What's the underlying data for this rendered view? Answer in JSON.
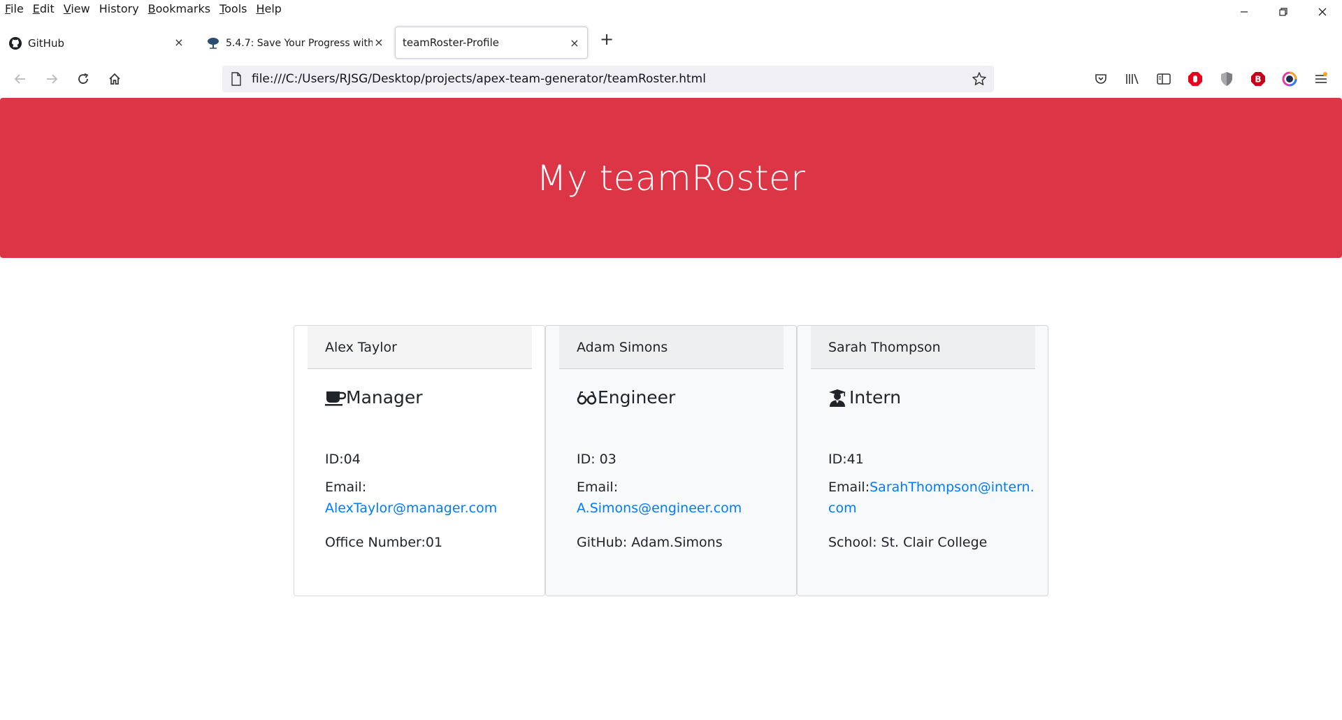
{
  "menu": {
    "items": [
      {
        "label": "File",
        "key": "F",
        "rest": "ile"
      },
      {
        "label": "Edit",
        "key": "E",
        "rest": "dit"
      },
      {
        "label": "View",
        "key": "V",
        "rest": "iew"
      },
      {
        "label": "History",
        "key": "",
        "rest": "History"
      },
      {
        "label": "Bookmarks",
        "key": "B",
        "rest": "ookmarks"
      },
      {
        "label": "Tools",
        "key": "T",
        "rest": "ools"
      },
      {
        "label": "Help",
        "key": "H",
        "rest": "elp"
      }
    ]
  },
  "tabs": [
    {
      "title": "GitHub",
      "icon": "github-icon",
      "active": false
    },
    {
      "title": "5.4.7: Save Your Progress with Gi",
      "icon": "tree-icon",
      "active": false
    },
    {
      "title": "teamRoster-Profile",
      "icon": "",
      "active": true
    }
  ],
  "urlbar": {
    "url": "file:///C:/Users/RJSG/Desktop/projects/apex-team-generator/teamRoster.html"
  },
  "page": {
    "heading": "My teamRoster",
    "hero_color": "#dc3545",
    "link_color": "#007bff"
  },
  "cards": [
    {
      "name": "Alex Taylor",
      "role": "Manager",
      "role_icon": "mug-icon",
      "id_line": "ID:04",
      "email_label": "Email:",
      "email": "AlexTaylor@manager.com",
      "extra": "Office Number:01"
    },
    {
      "name": "Adam Simons",
      "role": "Engineer",
      "role_icon": "glasses-icon",
      "id_line": "ID: 03",
      "email_label": "Email:",
      "email": "A.Simons@engineer.com",
      "extra": "GitHub: Adam.Simons"
    },
    {
      "name": "Sarah Thompson",
      "role": "Intern",
      "role_icon": "graduate-icon",
      "id_line": "ID:41",
      "email_label": "Email:",
      "email_part1": "SarahThompson@intern.",
      "email_part2": "com",
      "extra": "School: St. Clair College"
    }
  ]
}
